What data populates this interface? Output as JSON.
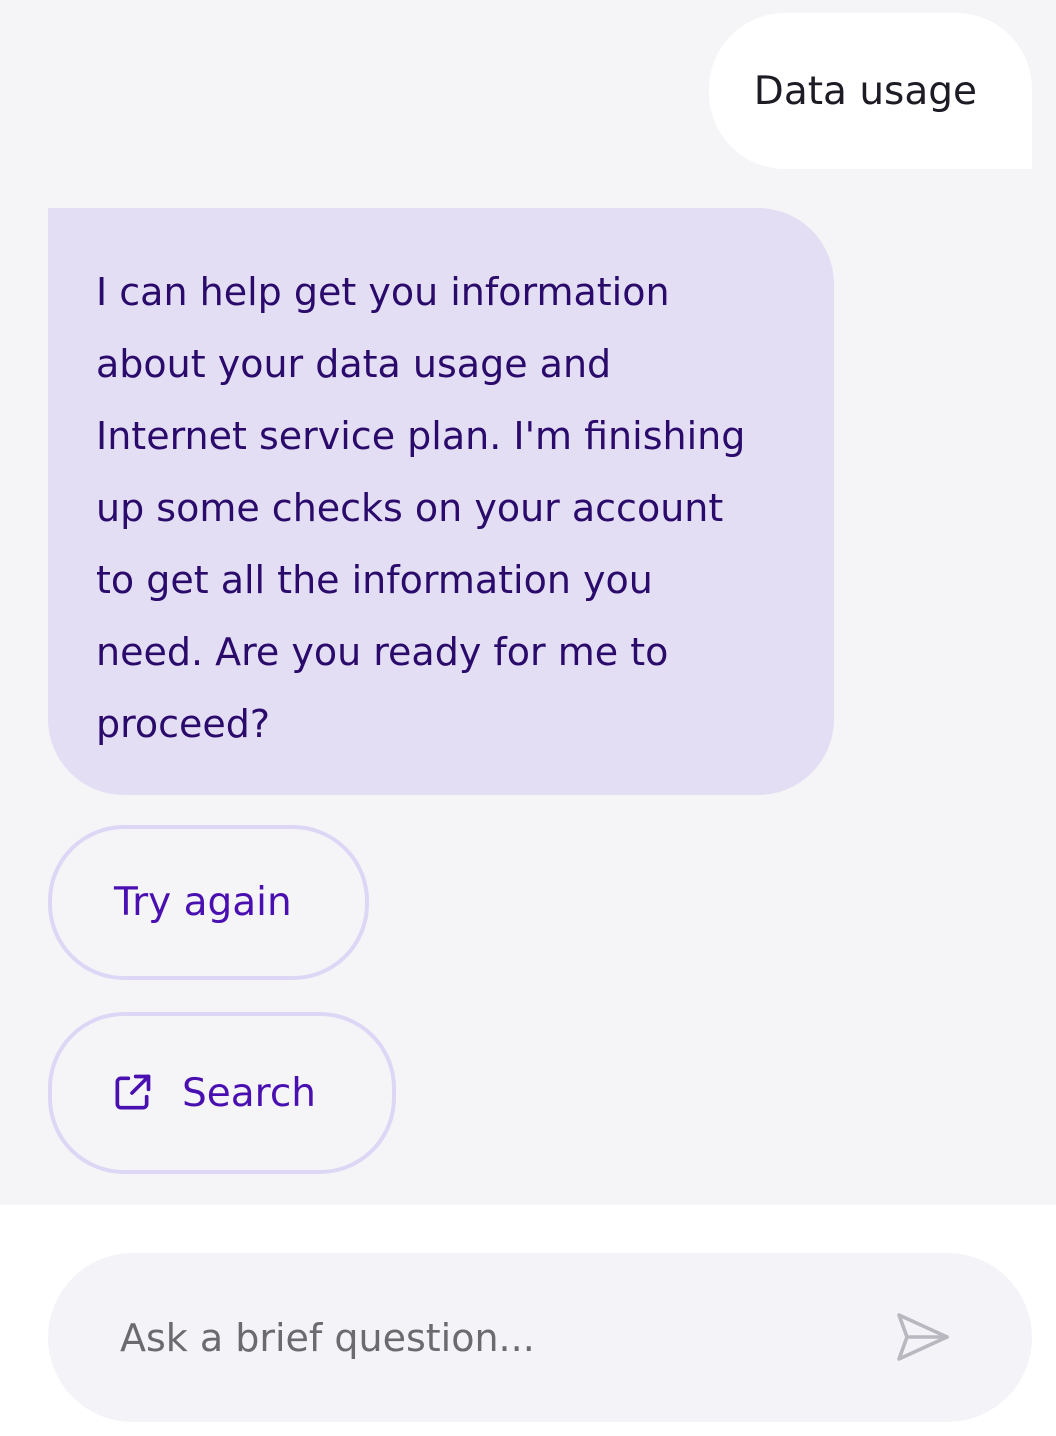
{
  "conversation": {
    "user_message": "Data usage",
    "bot_message": "I can help get you information\nabout your data usage and\nInternet service plan. I'm finishing\nup some checks on your account\nto get all the information you\nneed. Are you ready for me to\nproceed?"
  },
  "actions": {
    "retry_label": "Try again",
    "search_label": "Search",
    "search_icon": "external-link-icon"
  },
  "composer": {
    "placeholder": "Ask a brief question...",
    "send_icon": "send-icon"
  },
  "colors": {
    "chat_background": "#f5f5f8",
    "bot_bubble": "#e3def3",
    "bot_text": "#2a0a6b",
    "accent": "#4a0fb0",
    "chip_border": "#ddd6f5"
  }
}
